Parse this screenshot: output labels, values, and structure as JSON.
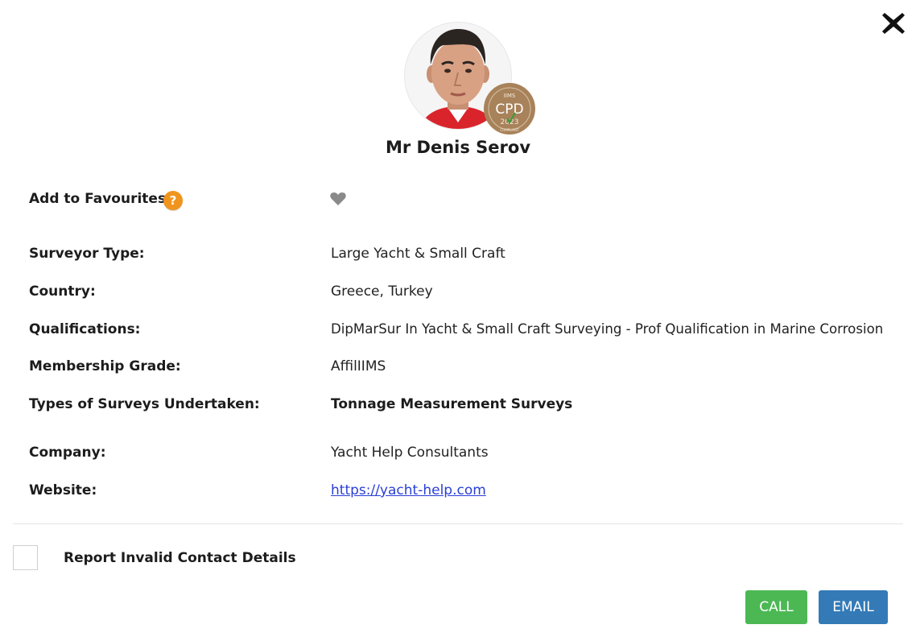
{
  "profile": {
    "name": "Mr Denis Serov",
    "badge": {
      "org": "IIMS",
      "title": "CPD",
      "year": "2023",
      "ring_text": "PROFESSIONAL DEVELOPMENT",
      "compliant": "COMPLIANT"
    }
  },
  "favourites": {
    "label": "Add to Favourites:",
    "help_glyph": "?",
    "help_icon": "question-icon",
    "heart_icon": "heart-icon"
  },
  "details": [
    {
      "label": "Surveyor Type:",
      "value": "Large Yacht & Small Craft"
    },
    {
      "label": "Country:",
      "value": "Greece, Turkey"
    },
    {
      "label": "Qualifications:",
      "value": "DipMarSur In Yacht & Small Craft Surveying - Prof Qualification in Marine Corrosion"
    },
    {
      "label": "Membership Grade:",
      "value": "AffilIIMS"
    },
    {
      "label": "Types of Surveys Undertaken:",
      "value": "Tonnage Measurement Surveys"
    },
    {
      "label": "Company:",
      "value": "Yacht Help Consultants"
    },
    {
      "label": "Website:",
      "value": "https://yacht-help.com"
    }
  ],
  "report": {
    "label": "Report Invalid Contact Details"
  },
  "actions": {
    "call_label": "CALL",
    "email_label": "EMAIL"
  },
  "colors": {
    "help": "#f0941d",
    "call": "#4cb854",
    "email": "#337ab7",
    "link": "#2a3fd6",
    "heart": "#8a8a8a",
    "badge": "#a8825a"
  },
  "icons": {
    "close": "close-icon"
  }
}
